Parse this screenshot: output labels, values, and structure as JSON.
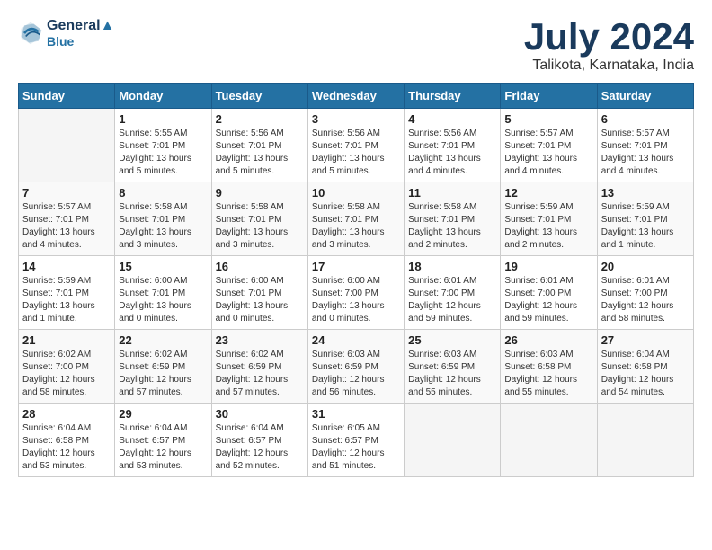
{
  "header": {
    "logo_line1": "General",
    "logo_line2": "Blue",
    "main_title": "July 2024",
    "subtitle": "Talikota, Karnataka, India"
  },
  "columns": [
    "Sunday",
    "Monday",
    "Tuesday",
    "Wednesday",
    "Thursday",
    "Friday",
    "Saturday"
  ],
  "weeks": [
    [
      {
        "day": "",
        "info": ""
      },
      {
        "day": "1",
        "info": "Sunrise: 5:55 AM\nSunset: 7:01 PM\nDaylight: 13 hours\nand 5 minutes."
      },
      {
        "day": "2",
        "info": "Sunrise: 5:56 AM\nSunset: 7:01 PM\nDaylight: 13 hours\nand 5 minutes."
      },
      {
        "day": "3",
        "info": "Sunrise: 5:56 AM\nSunset: 7:01 PM\nDaylight: 13 hours\nand 5 minutes."
      },
      {
        "day": "4",
        "info": "Sunrise: 5:56 AM\nSunset: 7:01 PM\nDaylight: 13 hours\nand 4 minutes."
      },
      {
        "day": "5",
        "info": "Sunrise: 5:57 AM\nSunset: 7:01 PM\nDaylight: 13 hours\nand 4 minutes."
      },
      {
        "day": "6",
        "info": "Sunrise: 5:57 AM\nSunset: 7:01 PM\nDaylight: 13 hours\nand 4 minutes."
      }
    ],
    [
      {
        "day": "7",
        "info": "Sunrise: 5:57 AM\nSunset: 7:01 PM\nDaylight: 13 hours\nand 4 minutes."
      },
      {
        "day": "8",
        "info": "Sunrise: 5:58 AM\nSunset: 7:01 PM\nDaylight: 13 hours\nand 3 minutes."
      },
      {
        "day": "9",
        "info": "Sunrise: 5:58 AM\nSunset: 7:01 PM\nDaylight: 13 hours\nand 3 minutes."
      },
      {
        "day": "10",
        "info": "Sunrise: 5:58 AM\nSunset: 7:01 PM\nDaylight: 13 hours\nand 3 minutes."
      },
      {
        "day": "11",
        "info": "Sunrise: 5:58 AM\nSunset: 7:01 PM\nDaylight: 13 hours\nand 2 minutes."
      },
      {
        "day": "12",
        "info": "Sunrise: 5:59 AM\nSunset: 7:01 PM\nDaylight: 13 hours\nand 2 minutes."
      },
      {
        "day": "13",
        "info": "Sunrise: 5:59 AM\nSunset: 7:01 PM\nDaylight: 13 hours\nand 1 minute."
      }
    ],
    [
      {
        "day": "14",
        "info": "Sunrise: 5:59 AM\nSunset: 7:01 PM\nDaylight: 13 hours\nand 1 minute."
      },
      {
        "day": "15",
        "info": "Sunrise: 6:00 AM\nSunset: 7:01 PM\nDaylight: 13 hours\nand 0 minutes."
      },
      {
        "day": "16",
        "info": "Sunrise: 6:00 AM\nSunset: 7:01 PM\nDaylight: 13 hours\nand 0 minutes."
      },
      {
        "day": "17",
        "info": "Sunrise: 6:00 AM\nSunset: 7:00 PM\nDaylight: 13 hours\nand 0 minutes."
      },
      {
        "day": "18",
        "info": "Sunrise: 6:01 AM\nSunset: 7:00 PM\nDaylight: 12 hours\nand 59 minutes."
      },
      {
        "day": "19",
        "info": "Sunrise: 6:01 AM\nSunset: 7:00 PM\nDaylight: 12 hours\nand 59 minutes."
      },
      {
        "day": "20",
        "info": "Sunrise: 6:01 AM\nSunset: 7:00 PM\nDaylight: 12 hours\nand 58 minutes."
      }
    ],
    [
      {
        "day": "21",
        "info": "Sunrise: 6:02 AM\nSunset: 7:00 PM\nDaylight: 12 hours\nand 58 minutes."
      },
      {
        "day": "22",
        "info": "Sunrise: 6:02 AM\nSunset: 6:59 PM\nDaylight: 12 hours\nand 57 minutes."
      },
      {
        "day": "23",
        "info": "Sunrise: 6:02 AM\nSunset: 6:59 PM\nDaylight: 12 hours\nand 57 minutes."
      },
      {
        "day": "24",
        "info": "Sunrise: 6:03 AM\nSunset: 6:59 PM\nDaylight: 12 hours\nand 56 minutes."
      },
      {
        "day": "25",
        "info": "Sunrise: 6:03 AM\nSunset: 6:59 PM\nDaylight: 12 hours\nand 55 minutes."
      },
      {
        "day": "26",
        "info": "Sunrise: 6:03 AM\nSunset: 6:58 PM\nDaylight: 12 hours\nand 55 minutes."
      },
      {
        "day": "27",
        "info": "Sunrise: 6:04 AM\nSunset: 6:58 PM\nDaylight: 12 hours\nand 54 minutes."
      }
    ],
    [
      {
        "day": "28",
        "info": "Sunrise: 6:04 AM\nSunset: 6:58 PM\nDaylight: 12 hours\nand 53 minutes."
      },
      {
        "day": "29",
        "info": "Sunrise: 6:04 AM\nSunset: 6:57 PM\nDaylight: 12 hours\nand 53 minutes."
      },
      {
        "day": "30",
        "info": "Sunrise: 6:04 AM\nSunset: 6:57 PM\nDaylight: 12 hours\nand 52 minutes."
      },
      {
        "day": "31",
        "info": "Sunrise: 6:05 AM\nSunset: 6:57 PM\nDaylight: 12 hours\nand 51 minutes."
      },
      {
        "day": "",
        "info": ""
      },
      {
        "day": "",
        "info": ""
      },
      {
        "day": "",
        "info": ""
      }
    ]
  ]
}
